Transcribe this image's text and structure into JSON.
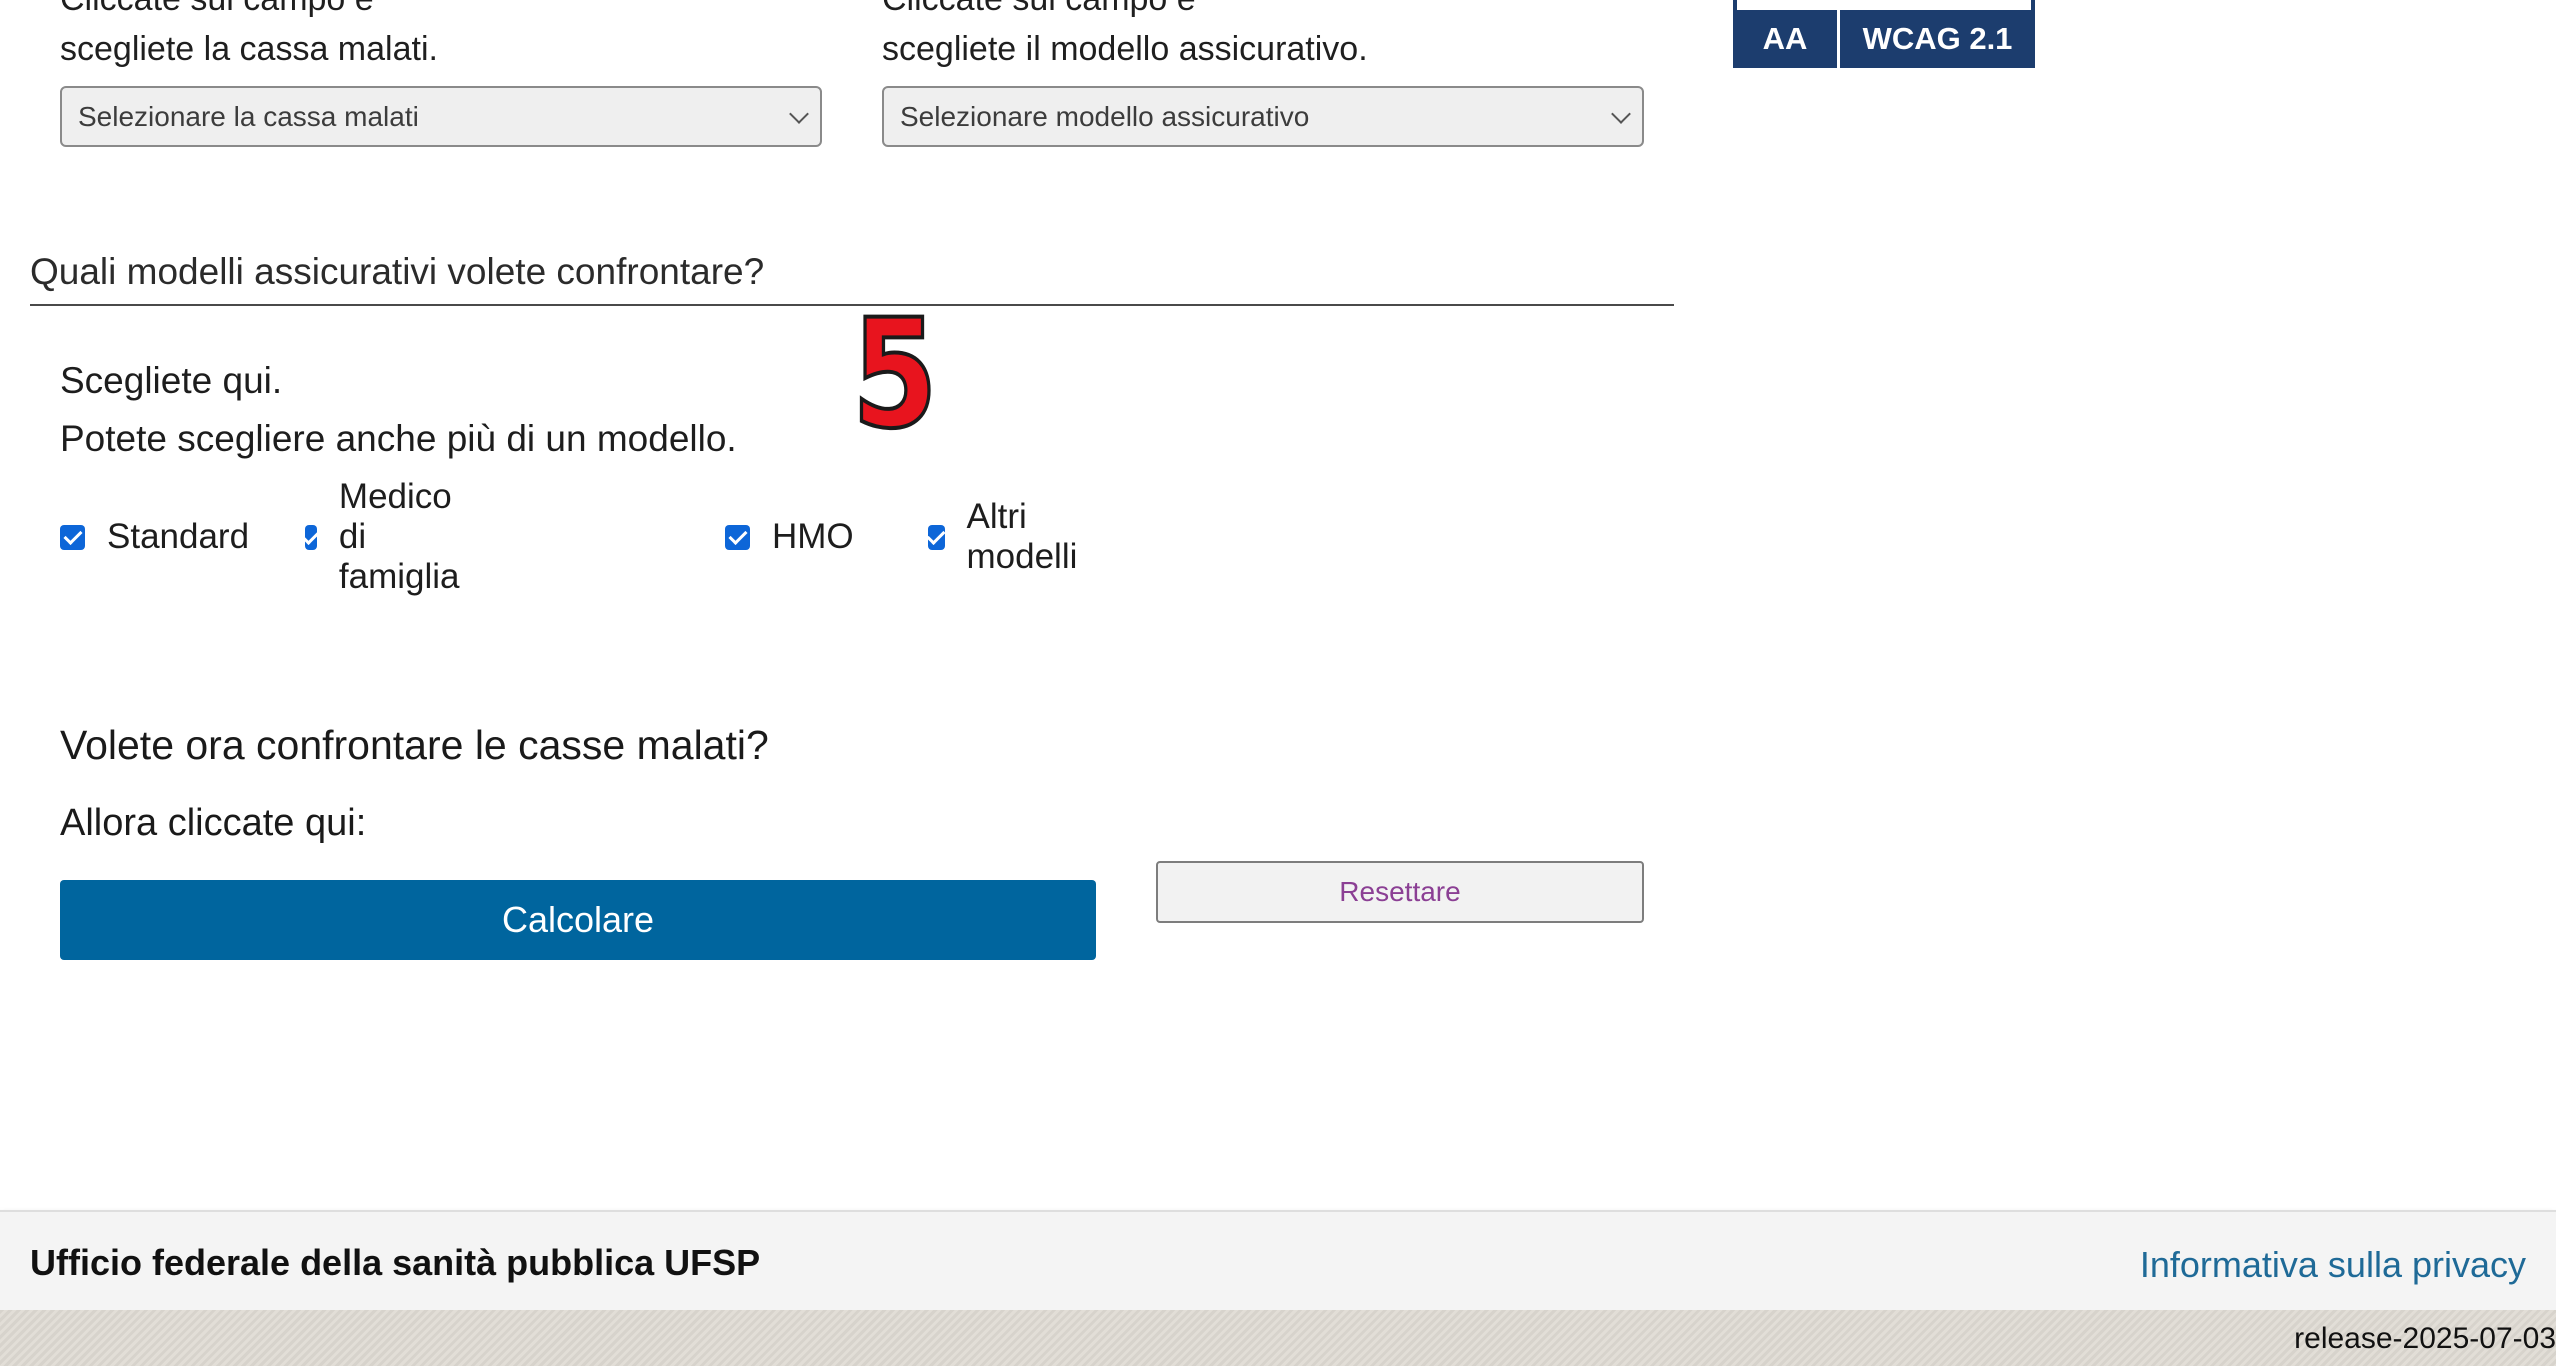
{
  "selection": {
    "left": {
      "hint_line1": "Cliccate sul campo e",
      "hint_line2": "scegliete la cassa malati.",
      "select_value": "Selezionare la cassa malati"
    },
    "right": {
      "hint_line1": "Cliccate sul campo e",
      "hint_line2": "scegliete il modello assicurativo.",
      "select_value": "Selezionare modello assicurativo"
    }
  },
  "wcag_badge": {
    "level": "AA",
    "version": "WCAG 2.1",
    "color": "#1c3d6e"
  },
  "models_section": {
    "heading": "Quali modelli assicurativi volete confrontare?",
    "instruction_line1": "Scegliete qui.",
    "instruction_line2": "Potete scegliere anche più di un modello.",
    "marker": "5",
    "options": [
      {
        "label": "Standard",
        "checked": true
      },
      {
        "label": "Medico di famiglia",
        "checked": true
      },
      {
        "label": "HMO",
        "checked": true
      },
      {
        "label": "Altri modelli",
        "checked": true
      }
    ]
  },
  "compare": {
    "title": "Volete ora confrontare le casse malati?",
    "subtitle": "Allora cliccate qui:",
    "calculate_label": "Calcolare",
    "reset_label": "Resettare"
  },
  "footer": {
    "org": "Ufficio federale della sanità pubblica UFSP",
    "privacy_link": "Informativa sulla privacy",
    "release": "release-2025-07-03"
  },
  "colors": {
    "primary_button": "#00659e",
    "checkbox": "#0d66d8",
    "reset_text": "#8b3f94",
    "link": "#1f6a97",
    "marker": "#e8141e"
  }
}
